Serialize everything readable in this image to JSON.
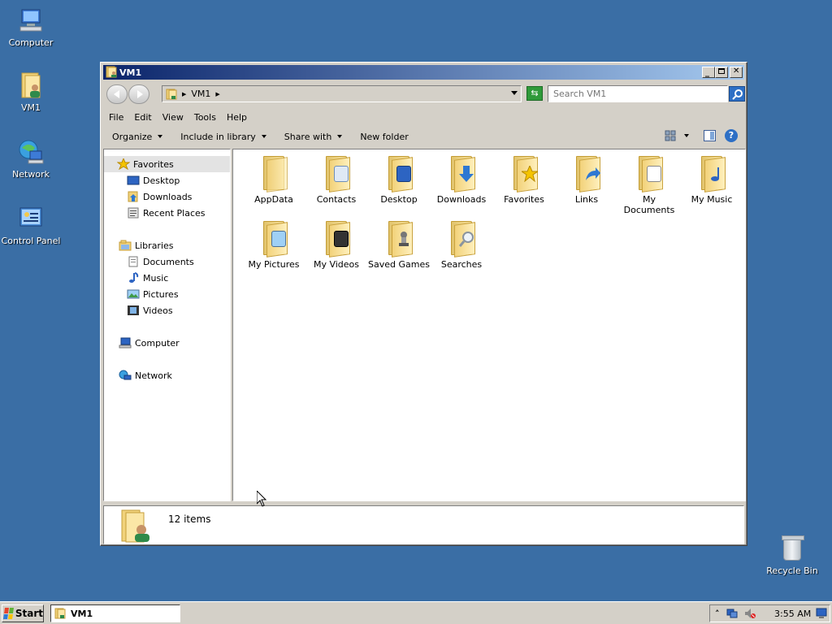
{
  "desktop": {
    "icons": [
      {
        "label": "Computer",
        "icon": "computer-icon"
      },
      {
        "label": "VM1",
        "icon": "user-folder-icon"
      },
      {
        "label": "Network",
        "icon": "network-icon"
      },
      {
        "label": "Control Panel",
        "icon": "control-panel-icon"
      }
    ],
    "recycle_bin": {
      "label": "Recycle Bin",
      "icon": "recycle-bin-icon"
    }
  },
  "window": {
    "title": "VM1",
    "address": {
      "path": "VM1"
    },
    "search": {
      "placeholder": "Search VM1"
    },
    "menu": [
      "File",
      "Edit",
      "View",
      "Tools",
      "Help"
    ],
    "commands": [
      "Organize",
      "Include in library",
      "Share with",
      "New folder"
    ],
    "nav": {
      "favorites": {
        "label": "Favorites",
        "items": [
          "Desktop",
          "Downloads",
          "Recent Places"
        ]
      },
      "libraries": {
        "label": "Libraries",
        "items": [
          "Documents",
          "Music",
          "Pictures",
          "Videos"
        ]
      },
      "computer": "Computer",
      "network": "Network"
    },
    "folders": [
      {
        "label": "AppData",
        "icon": "appdata-folder-icon"
      },
      {
        "label": "Contacts",
        "icon": "contacts-folder-icon"
      },
      {
        "label": "Desktop",
        "icon": "desktop-folder-icon"
      },
      {
        "label": "Downloads",
        "icon": "downloads-folder-icon"
      },
      {
        "label": "Favorites",
        "icon": "favorites-folder-icon"
      },
      {
        "label": "Links",
        "icon": "links-folder-icon"
      },
      {
        "label": "My Documents",
        "icon": "documents-folder-icon"
      },
      {
        "label": "My Music",
        "icon": "music-folder-icon"
      },
      {
        "label": "My Pictures",
        "icon": "pictures-folder-icon"
      },
      {
        "label": "My Videos",
        "icon": "videos-folder-icon"
      },
      {
        "label": "Saved Games",
        "icon": "saved-games-folder-icon"
      },
      {
        "label": "Searches",
        "icon": "searches-folder-icon"
      }
    ],
    "details": {
      "count_text": "12 items"
    }
  },
  "taskbar": {
    "start_label": "Start",
    "task_label": "VM1",
    "clock": "3:55 AM"
  },
  "colors": {
    "desktop": "#3a6ea5",
    "title_start": "#0a246a",
    "title_end": "#a6caf0"
  }
}
